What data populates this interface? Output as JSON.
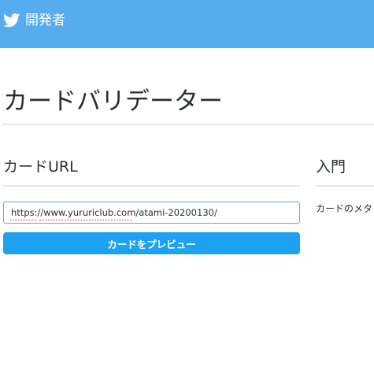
{
  "header": {
    "brand_label": "開発者",
    "bar_color": "#55acee"
  },
  "page": {
    "title": "カードバリデーター"
  },
  "card_url_section": {
    "heading": "カードURL",
    "input_value": "https://www.yururiclub.com/atami-20200130/",
    "preview_button_label": "カードをプレビュー",
    "button_color": "#1da1f2"
  },
  "intro_section": {
    "heading": "入門",
    "text": "カードのメタ"
  }
}
